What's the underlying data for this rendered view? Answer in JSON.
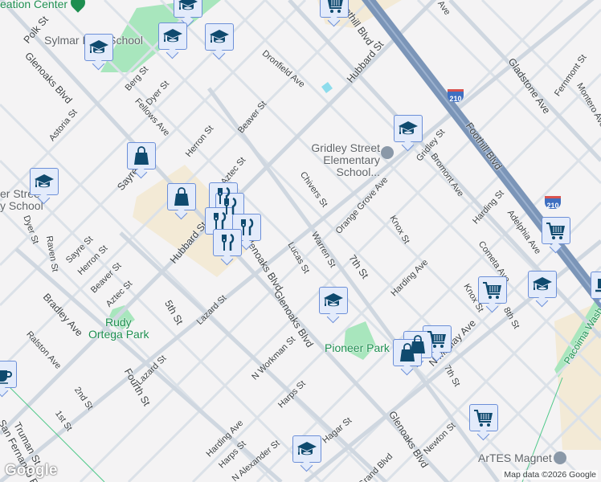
{
  "map": {
    "attribution": "Map data ©2026 Google",
    "logo": "Google",
    "colors": {
      "road": "#d4dbe3",
      "arterial": "#cfd7e0",
      "freeway": "#7b95b8",
      "park": "#a8e6bd",
      "campus": "#f3ead6",
      "marker_fill": "#e3ebfb",
      "marker_border": "#6c8fd8",
      "icon": "#0f4a6e"
    },
    "streets": {
      "polk": "Polk St",
      "glenoaks1": "Glenoaks Blvd",
      "glenoaks2": "Glenoaks Blvd",
      "glenoaks3": "Glenoaks Blvd",
      "glenoaks4": "Glenoaks Blvd",
      "berg": "Berg St",
      "dyer1": "Dyer St",
      "dyer2": "Dyer St",
      "fellows": "Fellows Ave",
      "astoria": "Astoria St",
      "herron1": "Herron St",
      "herron2": "Herron St",
      "beaver1": "Beaver St",
      "beaver2": "Beaver St",
      "aztec1": "Aztec St",
      "aztec2": "Aztec St",
      "sayre1": "Sayre St",
      "sayre2": "Sayre St",
      "dronfield": "Dronfield Ave",
      "hubbard1": "Hubbard St",
      "hubbard2": "Hubbard St",
      "foothill1": "Foothill Blvd",
      "foothill2": "Foothill Blvd",
      "gladstone": "Gladstone Ave",
      "fernmont": "Fernmont St",
      "montero": "Montero Ave",
      "gridley": "Gridley St",
      "bromont": "Bromont Ave",
      "chivers": "Chivers St",
      "orange": "Orange Grove Ave",
      "knox1": "Knox St",
      "knox2": "Knox St",
      "harding1": "Harding St",
      "adelphia": "Adelphia Ave",
      "cometa": "Cometa Ave",
      "eighth": "8th St",
      "seventh1": "7th St",
      "seventh2": "7th St",
      "warren": "Warren St",
      "lucas": "Lucas St",
      "hardingave1": "Harding Ave",
      "hardingave2": "Harding Ave",
      "maclay": "N Maclay Ave",
      "raven": "Raven St",
      "bradley": "Bradley Ave",
      "fifth": "5th St",
      "fourth": "Fourth St",
      "lazard1": "Lazard St",
      "lazard2": "Lazard St",
      "ralston": "Ralston Ave",
      "second": "2nd St",
      "first": "1st St",
      "truman": "Truman St",
      "sanfernando": "San Fernando Rd",
      "workman": "N Workman St",
      "harps1": "Harps St",
      "harps2": "Harps St",
      "alexander": "N Alexander St",
      "hagar": "Hagar St",
      "newton": "Newton St",
      "grand": "Grand Blvd",
      "ave_top": "Ave"
    },
    "pois": {
      "recreation": "eation Center",
      "sylmar": "Sylmar High School",
      "gridley_school": "Gridley Street Elementary School...",
      "dyer_school_1": "er Street",
      "dyer_school_2": "y School",
      "rudy1": "Rudy",
      "rudy2": "Ortega Park",
      "pioneer": "Pioneer Park",
      "artes": "ArTES Magnet",
      "pacoima": "Pacoima Wash"
    },
    "highway_shield": "210",
    "markers": [
      {
        "type": "school",
        "icon": "graduation-cap"
      },
      {
        "type": "shopping",
        "icon": "shopping-bag"
      },
      {
        "type": "grocery",
        "icon": "shopping-cart"
      },
      {
        "type": "restaurant",
        "icon": "fork-knife"
      },
      {
        "type": "cafe",
        "icon": "coffee-cup"
      }
    ]
  }
}
